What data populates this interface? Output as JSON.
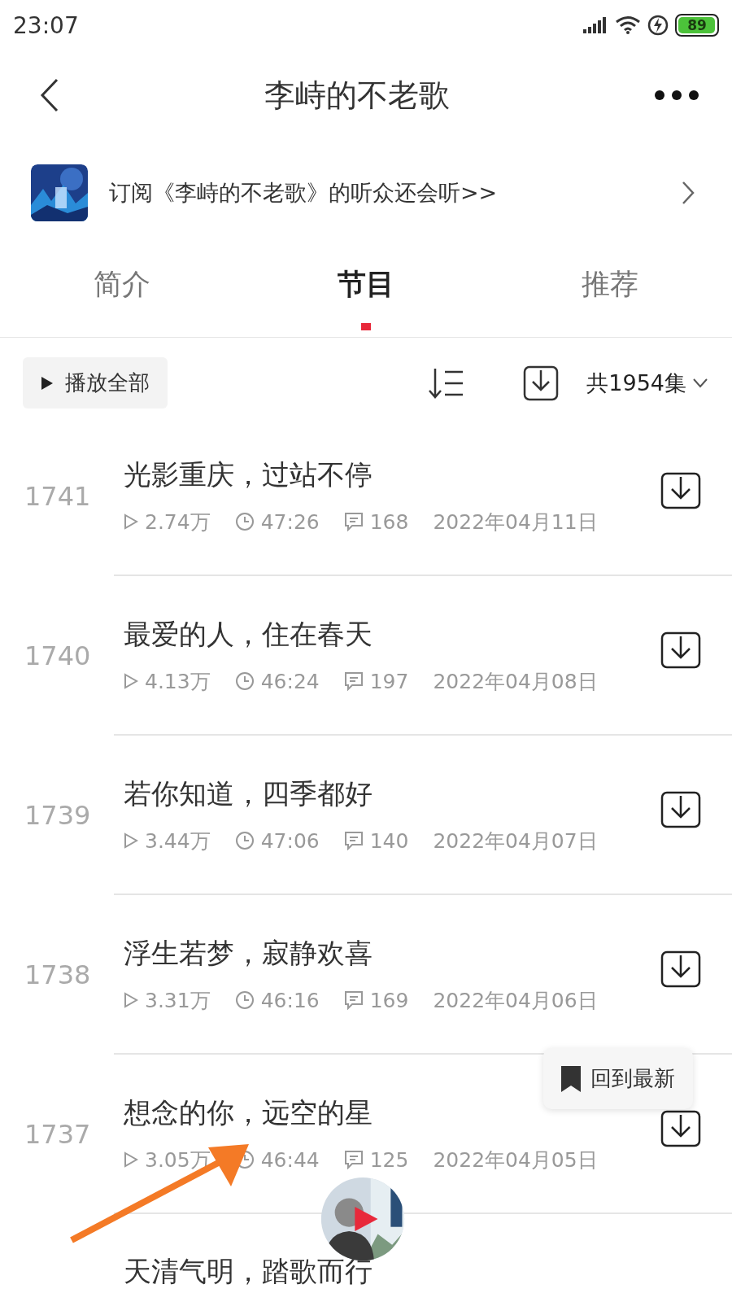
{
  "status_bar": {
    "time": "23:07",
    "battery": "89"
  },
  "header": {
    "title": "李峙的不老歌"
  },
  "promo": {
    "text": "订阅《李峙的不老歌》的听众还会听>>"
  },
  "tabs": [
    {
      "label": "简介",
      "selected": false
    },
    {
      "label": "节目",
      "selected": true
    },
    {
      "label": "推荐",
      "selected": false
    }
  ],
  "toolbar": {
    "play_all": "播放全部",
    "count": "共1954集"
  },
  "episodes": [
    {
      "number": "1741",
      "title": "光影重庆，过站不停",
      "plays": "2.74万",
      "duration": "47:26",
      "comments": "168",
      "date": "2022年04月11日"
    },
    {
      "number": "1740",
      "title": "最爱的人，住在春天",
      "plays": "4.13万",
      "duration": "46:24",
      "comments": "197",
      "date": "2022年04月08日"
    },
    {
      "number": "1739",
      "title": "若你知道，四季都好",
      "plays": "3.44万",
      "duration": "47:06",
      "comments": "140",
      "date": "2022年04月07日"
    },
    {
      "number": "1738",
      "title": "浮生若梦，寂静欢喜",
      "plays": "3.31万",
      "duration": "46:16",
      "comments": "169",
      "date": "2022年04月06日"
    },
    {
      "number": "1737",
      "title": "想念的你，远空的星",
      "plays": "3.05万",
      "duration": "46:44",
      "comments": "125",
      "date": "2022年04月05日"
    },
    {
      "title": "天清气明，踏歌而行"
    }
  ],
  "back_to_latest": "回到最新"
}
